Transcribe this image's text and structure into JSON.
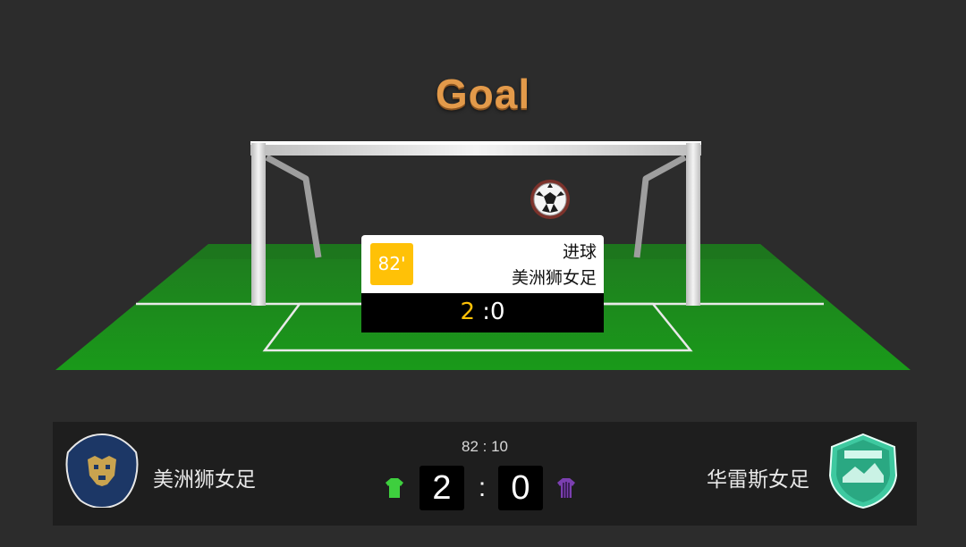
{
  "title": "Goal",
  "event": {
    "minute": "82'",
    "type": "进球",
    "team": "美洲狮女足",
    "score_home": "2",
    "score_away": ":0"
  },
  "match": {
    "clock": "82 : 10",
    "home": {
      "name": "美洲狮女足",
      "score": "2",
      "jersey_color": "#3ecf3e",
      "logo_color": "#1c3766",
      "logo_accent": "#c9a34f"
    },
    "away": {
      "name": "华雷斯女足",
      "score": "0",
      "jersey_color": "#7b3fb0",
      "logo_color": "#3ec9a0"
    },
    "separator": ":"
  },
  "icons": [
    "soccer-ball-icon",
    "home-team-logo",
    "away-team-logo",
    "home-jersey-icon",
    "away-jersey-icon"
  ]
}
